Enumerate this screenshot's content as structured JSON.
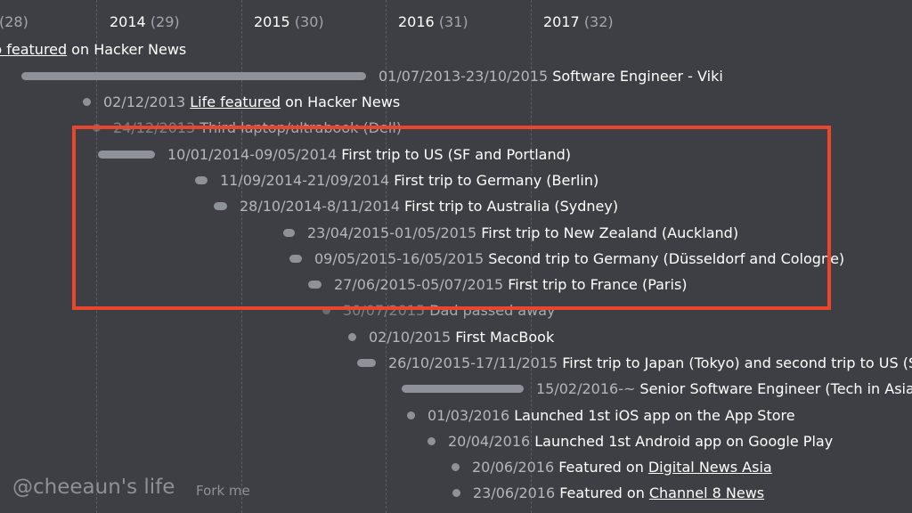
{
  "years": [
    {
      "label": "",
      "count": "(28)"
    },
    {
      "label": "2014",
      "count": "(29)"
    },
    {
      "label": "2015",
      "count": "(30)"
    },
    {
      "label": "2016",
      "count": "(31)"
    },
    {
      "label": "2017",
      "count": "(32)"
    }
  ],
  "top_line": {
    "link": "b featured",
    "suffix": "on Hacker News"
  },
  "events": [
    {
      "kind": "bar",
      "date": "01/07/2013-23/10/2015",
      "title": "Software Engineer - Viki"
    },
    {
      "kind": "dot",
      "date": "02/12/2013",
      "link": "Life featured",
      "title": "on Hacker News"
    },
    {
      "kind": "dot",
      "date": "24/12/2013",
      "title": "Third laptop/ultrabook (Dell)"
    },
    {
      "kind": "bar",
      "date": "10/01/2014-09/05/2014",
      "title": "First trip to US (SF and Portland)"
    },
    {
      "kind": "bar",
      "date": "11/09/2014-21/09/2014",
      "title": "First trip to Germany (Berlin)"
    },
    {
      "kind": "bar",
      "date": "28/10/2014-8/11/2014",
      "title": "First trip to Australia (Sydney)"
    },
    {
      "kind": "bar",
      "date": "23/04/2015-01/05/2015",
      "title": "First trip to New Zealand (Auckland)"
    },
    {
      "kind": "bar",
      "date": "09/05/2015-16/05/2015",
      "title": "Second trip to Germany (Düsseldorf and Cologne)"
    },
    {
      "kind": "bar",
      "date": "27/06/2015-05/07/2015",
      "title": "First trip to France (Paris)"
    },
    {
      "kind": "dot",
      "date": "30/07/2015",
      "title": "Dad passed away"
    },
    {
      "kind": "dot",
      "date": "02/10/2015",
      "title": "First MacBook"
    },
    {
      "kind": "bar",
      "date": "26/10/2015-17/11/2015",
      "title": "First trip to Japan (Tokyo) and second trip to US (SF)"
    },
    {
      "kind": "bar",
      "date": "15/02/2016-~",
      "title": "Senior Software Engineer (Tech in Asia)"
    },
    {
      "kind": "dot",
      "date": "01/03/2016",
      "title": "Launched 1st iOS app on the App Store"
    },
    {
      "kind": "dot",
      "date": "20/04/2016",
      "title": "Launched 1st Android app on Google Play"
    },
    {
      "kind": "dot",
      "date": "20/06/2016",
      "title": "Featured on",
      "link": "Digital News Asia"
    },
    {
      "kind": "dot",
      "date": "23/06/2016",
      "title": "Featured on",
      "link": "Channel 8 News"
    }
  ],
  "footer": {
    "brand": "@cheeaun's life",
    "fork": "Fork me"
  },
  "colors": {
    "background": "#3d3f44",
    "marker": "#8e9197",
    "highlight": "#e8472e"
  }
}
